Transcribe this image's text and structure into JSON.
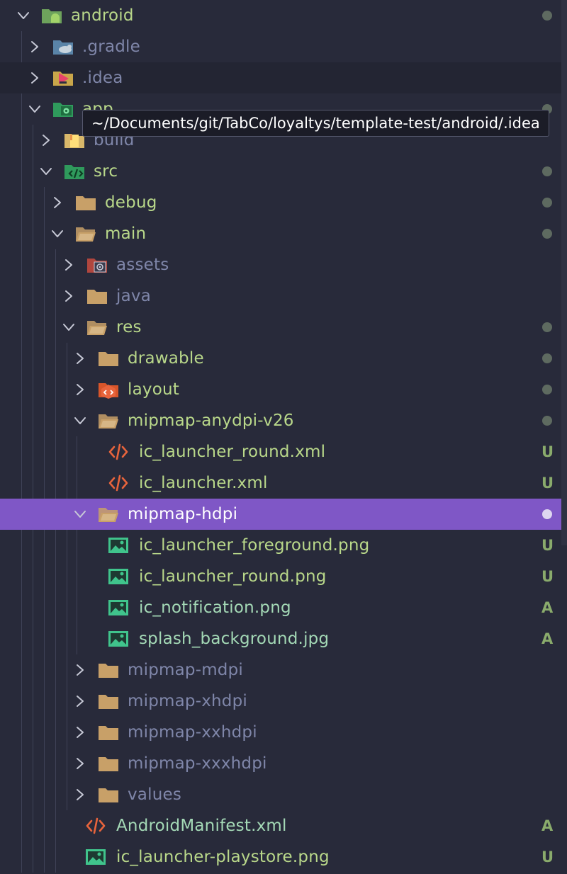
{
  "tree": [
    {
      "label": "android",
      "depth": 0,
      "expanded": true,
      "kind": "folder-android",
      "decoration": "dot",
      "color": "green"
    },
    {
      "label": ".gradle",
      "depth": 1,
      "expanded": false,
      "kind": "folder-gradle",
      "color": "dim"
    },
    {
      "label": ".idea",
      "depth": 1,
      "expanded": false,
      "kind": "folder-idea",
      "color": "dim",
      "hover": true
    },
    {
      "label": "app",
      "depth": 1,
      "expanded": true,
      "kind": "folder-app",
      "decoration": "dot",
      "color": "green"
    },
    {
      "label": "build",
      "depth": 2,
      "expanded": false,
      "kind": "folder-build",
      "color": "dim"
    },
    {
      "label": "src",
      "depth": 2,
      "expanded": true,
      "kind": "folder-src",
      "decoration": "dot",
      "color": "green"
    },
    {
      "label": "debug",
      "depth": 3,
      "expanded": false,
      "kind": "folder",
      "decoration": "dot",
      "color": "green"
    },
    {
      "label": "main",
      "depth": 3,
      "expanded": true,
      "kind": "folder-open",
      "decoration": "dot",
      "color": "green"
    },
    {
      "label": "assets",
      "depth": 4,
      "expanded": false,
      "kind": "folder-assets",
      "color": "dim"
    },
    {
      "label": "java",
      "depth": 4,
      "expanded": false,
      "kind": "folder",
      "color": "dim"
    },
    {
      "label": "res",
      "depth": 4,
      "expanded": true,
      "kind": "folder-open",
      "decoration": "dot",
      "color": "green"
    },
    {
      "label": "drawable",
      "depth": 5,
      "expanded": false,
      "kind": "folder",
      "decoration": "dot",
      "color": "green"
    },
    {
      "label": "layout",
      "depth": 5,
      "expanded": false,
      "kind": "folder-layout",
      "decoration": "dot",
      "color": "green"
    },
    {
      "label": "mipmap-anydpi-v26",
      "depth": 5,
      "expanded": true,
      "kind": "folder-open",
      "decoration": "dot",
      "color": "green"
    },
    {
      "label": "ic_launcher_round.xml",
      "depth": 6,
      "kind": "file-xml",
      "status": "U",
      "color": "green"
    },
    {
      "label": "ic_launcher.xml",
      "depth": 6,
      "kind": "file-xml",
      "status": "U",
      "color": "green"
    },
    {
      "label": "mipmap-hdpi",
      "depth": 5,
      "expanded": true,
      "kind": "folder-open",
      "decoration": "dot",
      "color": "white",
      "selected": true
    },
    {
      "label": "ic_launcher_foreground.png",
      "depth": 6,
      "kind": "file-image",
      "status": "U",
      "color": "green"
    },
    {
      "label": "ic_launcher_round.png",
      "depth": 6,
      "kind": "file-image",
      "status": "U",
      "color": "green"
    },
    {
      "label": "ic_notification.png",
      "depth": 6,
      "kind": "file-image",
      "status": "A",
      "color": "teal"
    },
    {
      "label": "splash_background.jpg",
      "depth": 6,
      "kind": "file-image",
      "status": "A",
      "color": "teal"
    },
    {
      "label": "mipmap-mdpi",
      "depth": 5,
      "expanded": false,
      "kind": "folder",
      "color": "dim"
    },
    {
      "label": "mipmap-xhdpi",
      "depth": 5,
      "expanded": false,
      "kind": "folder",
      "color": "dim"
    },
    {
      "label": "mipmap-xxhdpi",
      "depth": 5,
      "expanded": false,
      "kind": "folder",
      "color": "dim"
    },
    {
      "label": "mipmap-xxxhdpi",
      "depth": 5,
      "expanded": false,
      "kind": "folder",
      "color": "dim"
    },
    {
      "label": "values",
      "depth": 5,
      "expanded": false,
      "kind": "folder",
      "color": "dim"
    },
    {
      "label": "AndroidManifest.xml",
      "depth": 4,
      "kind": "file-xml",
      "status": "A",
      "color": "teal"
    },
    {
      "label": "ic_launcher-playstore.png",
      "depth": 4,
      "kind": "file-image",
      "status": "U",
      "color": "green"
    }
  ],
  "tooltip": {
    "text": "~/Documents/git/TabCo/loyaltys/template-test/android/.idea"
  },
  "colors": {
    "background": "#282a3a",
    "selection": "#7f57c6",
    "label_green": "#b9d88a",
    "label_teal": "#a4d9b6",
    "label_dim": "#7f86a9",
    "status": "#8aab6c",
    "folder": "#c8a068",
    "xml_icon": "#e8643c",
    "image_icon": "#40c48c"
  }
}
